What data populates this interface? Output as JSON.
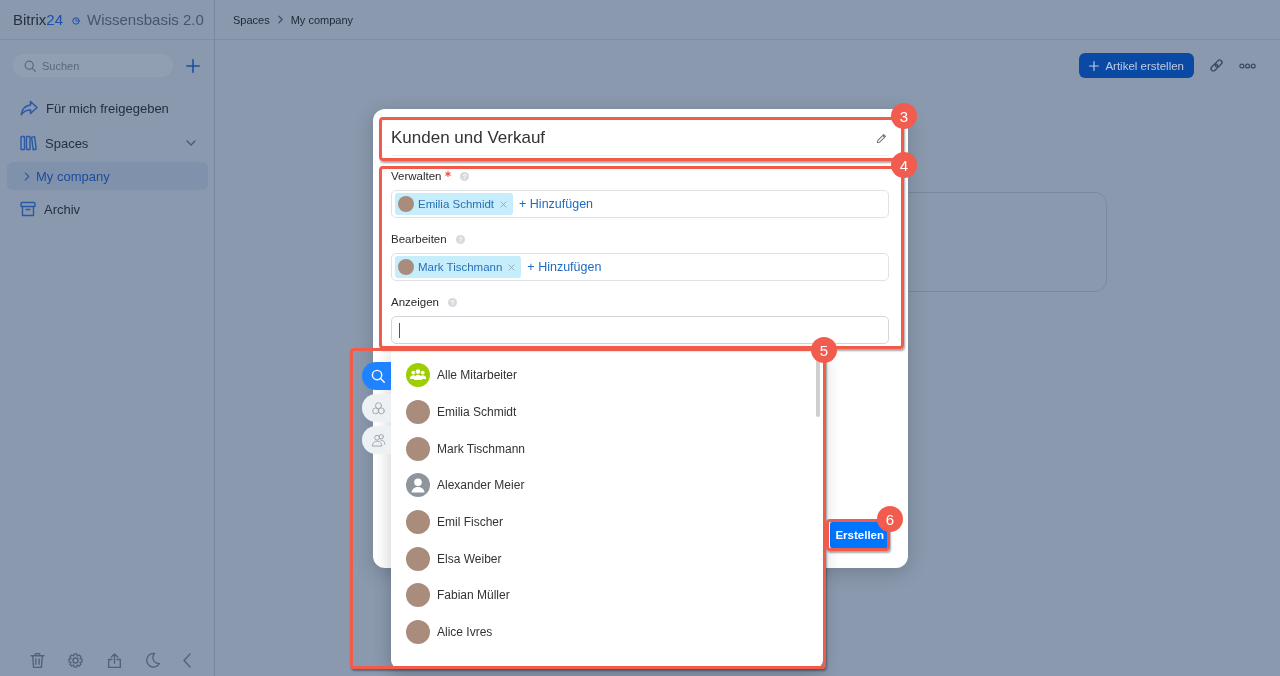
{
  "header": {
    "logo": {
      "name": "Bitrix",
      "number": "24"
    },
    "app_title": "Wissensbasis 2.0",
    "breadcrumbs": [
      "Spaces",
      "My company"
    ]
  },
  "sidebar": {
    "search": {
      "placeholder": "Suchen"
    },
    "items": [
      {
        "label": "Für mich freigegeben",
        "kind": "shared",
        "selected": false
      },
      {
        "label": "Spaces",
        "kind": "spaces",
        "selected": false,
        "expanded": true,
        "children": [
          {
            "label": "My company",
            "selected": true,
            "expanded": false
          }
        ]
      },
      {
        "label": "Archiv",
        "kind": "archive",
        "selected": false
      }
    ]
  },
  "toolbar": {
    "create_button": "Artikel erstellen"
  },
  "modal": {
    "title": "Kunden und Verkauf",
    "fields": [
      {
        "label": "Verwalten",
        "required": true,
        "focused": false,
        "chips": [
          {
            "name": "Emilia Schmidt"
          }
        ],
        "add_link": "+ Hinzufügen"
      },
      {
        "label": "Bearbeiten",
        "required": false,
        "focused": false,
        "chips": [
          {
            "name": "Mark Tischmann"
          }
        ],
        "add_link": "+ Hinzufügen"
      },
      {
        "label": "Anzeigen",
        "required": false,
        "focused": true
      }
    ],
    "submit_button": "Erstellen"
  },
  "selector": {
    "tabs": [
      {
        "kind": "search",
        "selected": true
      },
      {
        "kind": "departments",
        "selected": false
      },
      {
        "kind": "people",
        "selected": false
      }
    ],
    "items": [
      {
        "name": "Alle Mitarbeiter",
        "kind": "group"
      },
      {
        "name": "Emilia Schmidt",
        "kind": "photo"
      },
      {
        "name": "Mark Tischmann",
        "kind": "photo"
      },
      {
        "name": "Alexander Meier",
        "kind": "default"
      },
      {
        "name": "Emil Fischer",
        "kind": "photo"
      },
      {
        "name": "Elsa Weiber",
        "kind": "photo"
      },
      {
        "name": "Fabian Müller",
        "kind": "photo"
      },
      {
        "name": "Alice Ivres",
        "kind": "photo"
      }
    ]
  },
  "annotations": [
    {
      "number": "3"
    },
    {
      "number": "4"
    },
    {
      "number": "5"
    },
    {
      "number": "6"
    }
  ]
}
